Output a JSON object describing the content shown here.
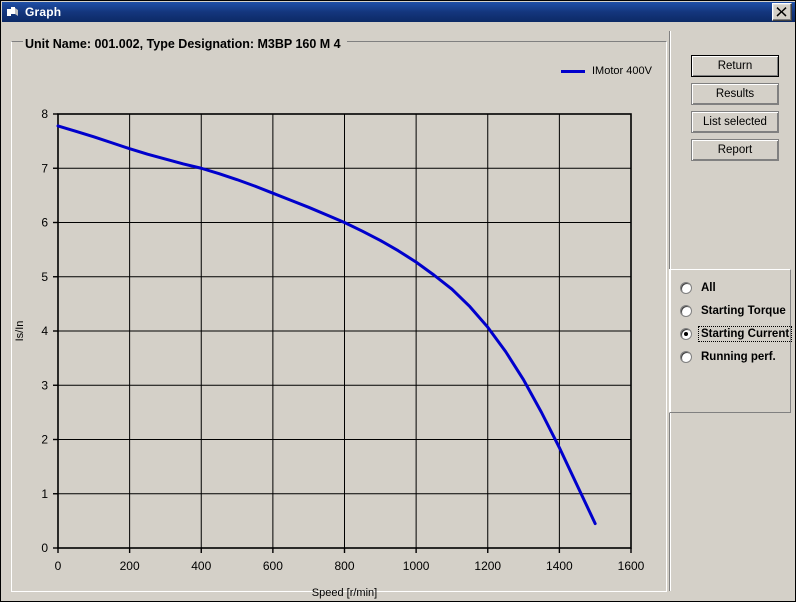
{
  "window": {
    "title": "Graph",
    "icon": "graph-window-icon",
    "close_label": "×",
    "background_color": "#d4d0c8",
    "titlebar_color": "#14367d"
  },
  "header": {
    "unit_info": "Unit Name: 001.002,  Type Designation: M3BP 160 M 4"
  },
  "legend": {
    "label": "IMotor 400V",
    "color": "#0000cc"
  },
  "buttons": [
    {
      "label": "Return",
      "focused": true
    },
    {
      "label": "Results",
      "focused": false
    },
    {
      "label": "List selected",
      "focused": false
    },
    {
      "label": "Report",
      "focused": false
    }
  ],
  "radio_group": {
    "options": [
      {
        "label": "All",
        "checked": false,
        "focused": false
      },
      {
        "label": "Starting Torque",
        "checked": false,
        "focused": false
      },
      {
        "label": "Starting Current",
        "checked": true,
        "focused": true
      },
      {
        "label": "Running perf.",
        "checked": false,
        "focused": false
      }
    ]
  },
  "chart_data": {
    "type": "line",
    "title": "",
    "xlabel": "Speed [r/min]",
    "ylabel": "Is/In",
    "xlim": [
      0,
      1600
    ],
    "ylim": [
      0,
      8
    ],
    "xticks": [
      0,
      200,
      400,
      600,
      800,
      1000,
      1200,
      1400,
      1600
    ],
    "yticks": [
      0,
      1,
      2,
      3,
      4,
      5,
      6,
      7,
      8
    ],
    "grid": true,
    "legend_position": "top-right",
    "series": [
      {
        "name": "IMotor 400V",
        "color": "#0000cc",
        "x": [
          0,
          50,
          100,
          150,
          200,
          250,
          300,
          350,
          400,
          450,
          500,
          550,
          600,
          650,
          700,
          750,
          800,
          850,
          900,
          950,
          1000,
          1050,
          1100,
          1150,
          1200,
          1250,
          1300,
          1350,
          1400,
          1450,
          1500
        ],
        "y": [
          7.78,
          7.68,
          7.58,
          7.47,
          7.36,
          7.26,
          7.17,
          7.08,
          7.0,
          6.9,
          6.79,
          6.67,
          6.54,
          6.41,
          6.28,
          6.14,
          6.0,
          5.84,
          5.67,
          5.48,
          5.27,
          5.03,
          4.77,
          4.45,
          4.07,
          3.62,
          3.1,
          2.5,
          1.85,
          1.15,
          0.45
        ]
      }
    ]
  }
}
